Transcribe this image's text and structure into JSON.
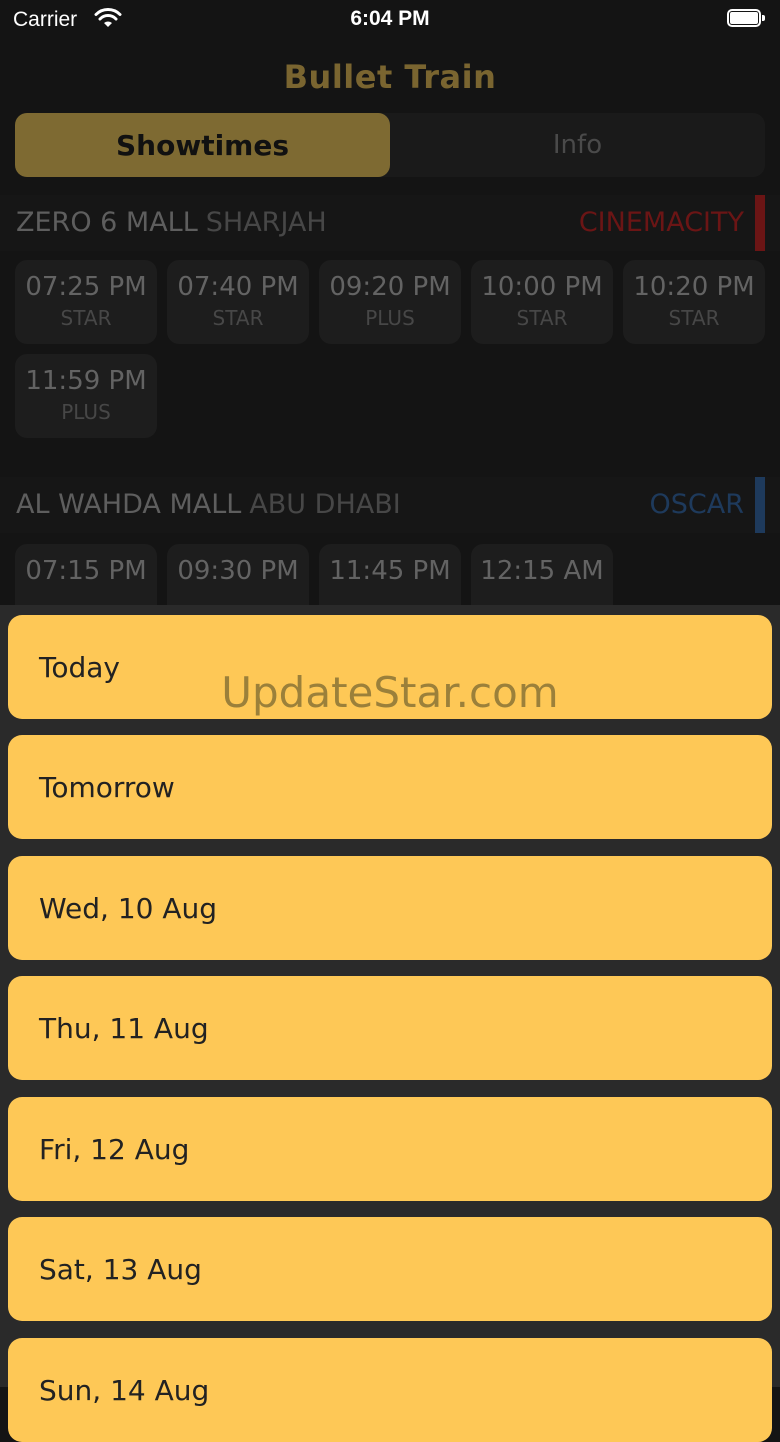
{
  "status_bar": {
    "carrier": "Carrier",
    "time": "6:04 PM"
  },
  "header": {
    "title": "Bullet Train"
  },
  "tabs": [
    {
      "label": "Showtimes"
    },
    {
      "label": "Info"
    }
  ],
  "cinemas": [
    {
      "mall": "ZERO 6 MALL",
      "city": "SHARJAH",
      "brand": "CINEMACITY",
      "brand_color": "#6b1515",
      "showtimes": [
        {
          "time": "07:25 PM",
          "format": "STAR"
        },
        {
          "time": "07:40 PM",
          "format": "STAR"
        },
        {
          "time": "09:20 PM",
          "format": "PLUS"
        },
        {
          "time": "10:00 PM",
          "format": "STAR"
        },
        {
          "time": "10:20 PM",
          "format": "STAR"
        },
        {
          "time": "11:59 PM",
          "format": "PLUS"
        }
      ]
    },
    {
      "mall": "AL WAHDA MALL",
      "city": "ABU DHABI",
      "brand": "OSCAR",
      "brand_color": "#1e3a5c",
      "showtimes": [
        {
          "time": "07:15 PM"
        },
        {
          "time": "09:30 PM"
        },
        {
          "time": "11:45 PM"
        },
        {
          "time": "12:15 AM"
        }
      ]
    }
  ],
  "date_picker": {
    "options": [
      "Today",
      "Tomorrow",
      "Wed, 10 Aug",
      "Thu, 11 Aug",
      "Fri, 12 Aug",
      "Sat, 13 Aug",
      "Sun, 14 Aug"
    ]
  },
  "watermark": "UpdateStar.com",
  "colors": {
    "accent": "#fec856",
    "background": "#141414"
  }
}
